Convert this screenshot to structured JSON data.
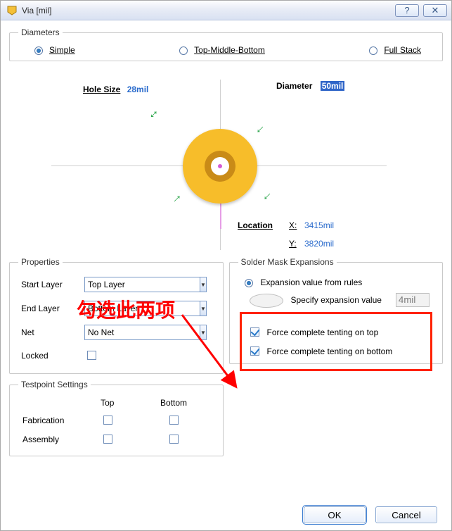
{
  "window": {
    "title": "Via [mil]"
  },
  "diameters": {
    "legend": "Diameters",
    "simple": "Simple",
    "tmb": "Top-Middle-Bottom",
    "full": "Full Stack",
    "selected": "simple"
  },
  "diagram": {
    "holeSizeLabel": "Hole Size",
    "holeSizeValue": "28mil",
    "diameterLabel": "Diameter",
    "diameterValue": "50mil",
    "locationLabel": "Location",
    "xLabel": "X:",
    "yLabel": "Y:",
    "xValue": "3415mil",
    "yValue": "3820mil"
  },
  "annotation": "勾选此两项",
  "properties": {
    "legend": "Properties",
    "startLayerLabel": "Start Layer",
    "startLayerValue": "Top Layer",
    "endLayerLabel": "End Layer",
    "endLayerValue": "Bottom Layer",
    "netLabel": "Net",
    "netValue": "No Net",
    "lockedLabel": "Locked",
    "lockedChecked": false
  },
  "testpoint": {
    "legend": "Testpoint Settings",
    "topLabel": "Top",
    "bottomLabel": "Bottom",
    "fabLabel": "Fabrication",
    "asmLabel": "Assembly"
  },
  "solder": {
    "legend": "Solder Mask Expansions",
    "fromRules": "Expansion value from rules",
    "specify": "Specify expansion value",
    "specifyValue": "4mil",
    "tentTop": "Force complete tenting on top",
    "tentBottom": "Force complete tenting on bottom"
  },
  "buttons": {
    "ok": "OK",
    "cancel": "Cancel"
  }
}
